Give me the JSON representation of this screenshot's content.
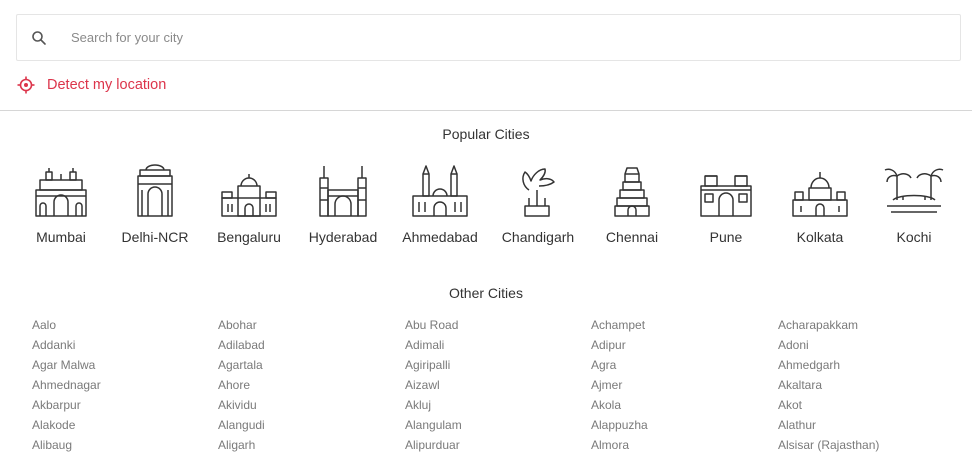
{
  "search": {
    "placeholder": "Search for your city",
    "value": ""
  },
  "detect": {
    "label": "Detect my location",
    "color": "#dc354b"
  },
  "popular": {
    "title": "Popular Cities",
    "cities": [
      {
        "name": "Mumbai",
        "icon": "gateway-of-india-icon"
      },
      {
        "name": "Delhi-NCR",
        "icon": "india-gate-icon"
      },
      {
        "name": "Bengaluru",
        "icon": "vidhana-soudha-icon"
      },
      {
        "name": "Hyderabad",
        "icon": "charminar-icon"
      },
      {
        "name": "Ahmedabad",
        "icon": "ahmedabad-mosque-icon"
      },
      {
        "name": "Chandigarh",
        "icon": "open-hand-monument-icon"
      },
      {
        "name": "Chennai",
        "icon": "temple-gopuram-icon"
      },
      {
        "name": "Pune",
        "icon": "shaniwar-wada-icon"
      },
      {
        "name": "Kolkata",
        "icon": "victoria-memorial-icon"
      },
      {
        "name": "Kochi",
        "icon": "kochi-backwaters-icon"
      }
    ]
  },
  "other": {
    "title": "Other Cities",
    "columns": [
      [
        "Aalo",
        "Addanki",
        "Agar Malwa",
        "Ahmednagar",
        "Akbarpur",
        "Alakode",
        "Alibaug"
      ],
      [
        "Abohar",
        "Adilabad",
        "Agartala",
        "Ahore",
        "Akividu",
        "Alangudi",
        "Aligarh"
      ],
      [
        "Abu Road",
        "Adimali",
        "Agiripalli",
        "Aizawl",
        "Akluj",
        "Alangulam",
        "Alipurduar"
      ],
      [
        "Achampet",
        "Adipur",
        "Agra",
        "Ajmer",
        "Akola",
        "Alappuzha",
        "Almora"
      ],
      [
        "Acharapakkam",
        "Adoni",
        "Ahmedgarh",
        "Akaltara",
        "Akot",
        "Alathur",
        "Alsisar (Rajasthan)"
      ]
    ]
  },
  "colors": {
    "accent": "#dc354b",
    "icon_stroke": "#333333",
    "muted_text": "#7a7a7a",
    "divider": "#d6d6d6"
  }
}
